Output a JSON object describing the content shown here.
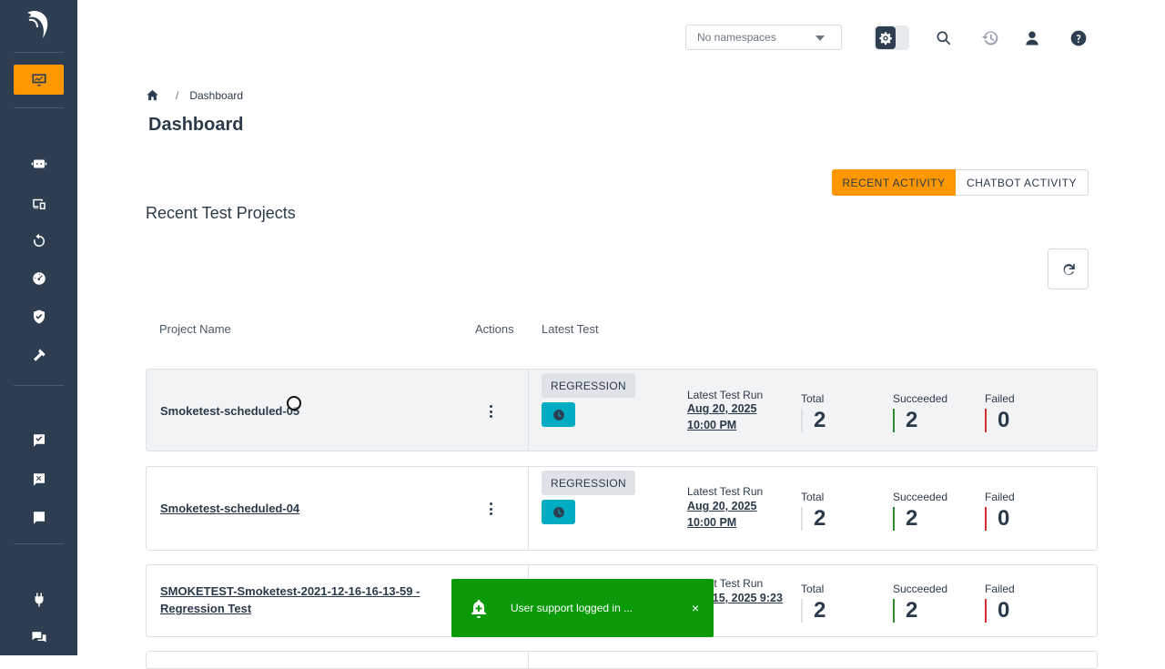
{
  "topbar": {
    "namespace_placeholder": "No namespaces"
  },
  "breadcrumb": {
    "current": "Dashboard"
  },
  "page": {
    "title": "Dashboard",
    "section_title": "Recent Test Projects"
  },
  "tabs": [
    {
      "label": "RECENT ACTIVITY",
      "active": true
    },
    {
      "label": "CHATBOT ACTIVITY",
      "active": false
    }
  ],
  "table": {
    "headers": {
      "project_name": "Project Name",
      "actions": "Actions",
      "latest_test": "Latest Test"
    },
    "rows": [
      {
        "name": "Smoketest-scheduled-05",
        "badge": "REGRESSION",
        "run_label": "Latest Test Run",
        "run_date": "Aug 20, 2025 10:00 PM",
        "total_label": "Total",
        "total": "2",
        "succeeded_label": "Succeeded",
        "succeeded": "2",
        "failed_label": "Failed",
        "failed": "0"
      },
      {
        "name": "Smoketest-scheduled-04",
        "badge": "REGRESSION",
        "run_label": "Latest Test Run",
        "run_date": "Aug 20, 2025 10:00 PM",
        "total_label": "Total",
        "total": "2",
        "succeeded_label": "Succeeded",
        "succeeded": "2",
        "failed_label": "Failed",
        "failed": "0"
      },
      {
        "name": "SMOKETEST-Smoketest-2021-12-16-16-13-59 - Regression Test",
        "run_label": "Latest Test Run",
        "run_date": "Aug 15, 2025 9:23",
        "total_label": "Total",
        "total": "2",
        "succeeded_label": "Succeeded",
        "succeeded": "2",
        "failed_label": "Failed",
        "failed": "0"
      }
    ]
  },
  "toast": {
    "message": "User support logged in ...",
    "close": "×"
  },
  "colors": {
    "sidebar": "#2c3e50",
    "accent": "#ff9800",
    "success": "#2e8b2e",
    "failure": "#d32f2f",
    "schedule": "#00acc1",
    "toast": "#0a9a0a"
  }
}
